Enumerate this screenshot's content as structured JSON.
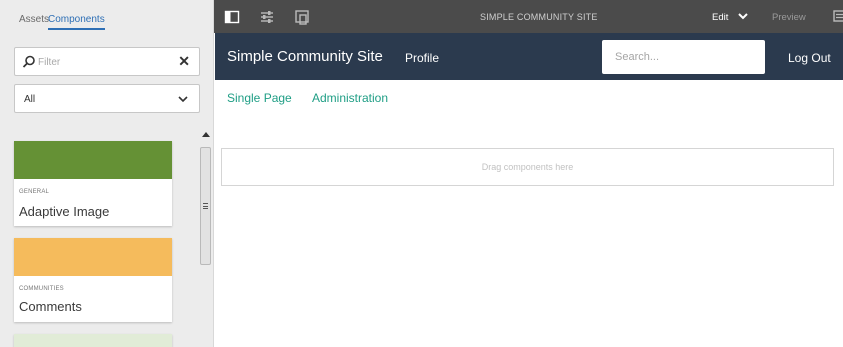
{
  "sidepanel": {
    "tabs": [
      {
        "label": "Assets"
      },
      {
        "label": "Components"
      }
    ],
    "filter": {
      "placeholder": "Filter"
    },
    "group_select": {
      "value": "All"
    },
    "components": [
      {
        "category": "GENERAL",
        "title": "Adaptive Image",
        "color": "#659135"
      },
      {
        "category": "COMMUNITIES",
        "title": "Comments",
        "color": "#f5bb5c"
      },
      {
        "category": "",
        "title": "",
        "color": "#e1ecd7"
      }
    ]
  },
  "toolbar": {
    "page_title": "SIMPLE COMMUNITY SITE",
    "mode_label": "Edit",
    "preview_label": "Preview",
    "icons": [
      "side-panel-toggle-icon",
      "page-properties-icon",
      "emulator-icon",
      "annotations-icon"
    ]
  },
  "site": {
    "header_title": "Simple Community Site",
    "profile_link": "Profile",
    "search_placeholder": "Search...",
    "logout_link": "Log Out",
    "nav": [
      {
        "label": "Single Page"
      },
      {
        "label": "Administration"
      }
    ],
    "dropzone_text": "Drag components here",
    "colors": {
      "header_bg": "#2b3a4e",
      "link": "#1f9e85",
      "toolbar_bg": "#4b4b4b"
    }
  }
}
